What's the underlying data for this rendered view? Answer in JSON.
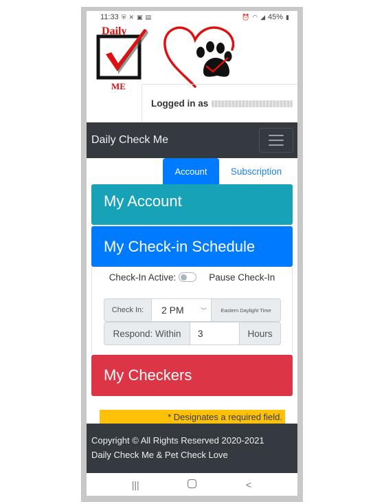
{
  "status_bar": {
    "time": "11:33",
    "battery": "45%",
    "left_icons": [
      "shield-icon",
      "tools-icon",
      "image-icon",
      "calendar-icon"
    ],
    "right_icons": [
      "alarm-icon",
      "wifi-icon",
      "signal-icon",
      "battery-icon"
    ]
  },
  "header": {
    "logo_daily_top": "Daily",
    "logo_daily_bottom": "ME",
    "logged_in_label": "Logged in as",
    "logged_in_user": "[redacted]"
  },
  "navbar": {
    "brand": "Daily Check Me",
    "menu_icon": "hamburger-icon"
  },
  "tabs": [
    {
      "label": "Account",
      "active": true
    },
    {
      "label": "Subscription",
      "active": false
    }
  ],
  "cards": {
    "account": {
      "title": "My Account",
      "color": "#17a2b8"
    },
    "schedule": {
      "title": "My Check-in Schedule",
      "color": "#007bff",
      "checkin_active_label": "Check-In Active:",
      "checkin_active": false,
      "pause_label": "Pause Check-In",
      "checkin_label": "Check In:",
      "checkin_time": "2 PM",
      "timezone": "Eastern Daylight Time",
      "respond_label": "Respond: Within",
      "respond_value": "3",
      "respond_unit": "Hours"
    },
    "checkers": {
      "title": "My Checkers",
      "color": "#dc3545"
    }
  },
  "required_note": "* Designates a required field.",
  "footer": {
    "line1": "Copyright © All Rights Reserved 2020-2021",
    "line2": "Daily Check Me & Pet Check Love"
  },
  "android_nav": {
    "recents": "|||",
    "back": "<"
  }
}
